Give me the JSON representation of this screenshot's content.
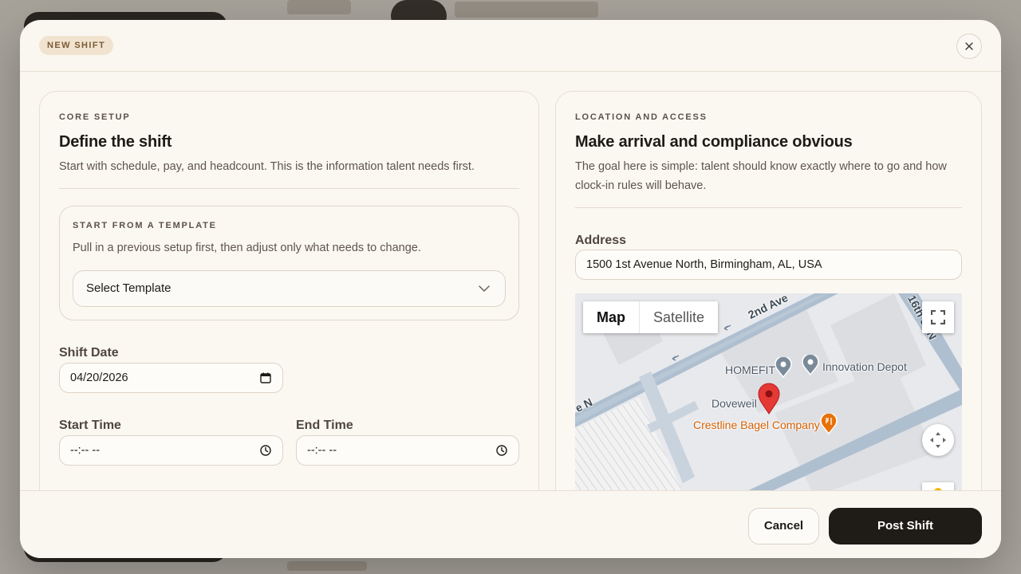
{
  "modal": {
    "badge": "NEW SHIFT",
    "close_icon": "close-icon"
  },
  "core": {
    "eyebrow": "CORE SETUP",
    "title": "Define the shift",
    "description": "Start with schedule, pay, and headcount. This is the information talent needs first.",
    "template": {
      "eyebrow": "START FROM A TEMPLATE",
      "description": "Pull in a previous setup first, then adjust only what needs to change.",
      "select_value": "Select Template"
    },
    "shift_date": {
      "label": "Shift Date",
      "value": "04/20/2026"
    },
    "start_time": {
      "label": "Start Time",
      "value": "--:-- --"
    },
    "end_time": {
      "label": "End Time",
      "value": "--:-- --"
    }
  },
  "location": {
    "eyebrow": "LOCATION AND ACCESS",
    "title": "Make arrival and compliance obvious",
    "description_line1": "The goal here is simple: talent should know exactly where to go and how",
    "description_line2": "clock-in rules will behave.",
    "address": {
      "label": "Address",
      "value": "1500 1st Avenue North, Birmingham, AL, USA"
    },
    "map": {
      "type_map": "Map",
      "type_satellite": "Satellite",
      "selected_type": "Map",
      "streets": [
        "2nd Ave",
        "16th St N",
        "e N"
      ],
      "places": {
        "homefit": "HOMEFIT",
        "innovation_depot": "Innovation Depot",
        "doveweil": "Doveweil",
        "crestline": "Crestline Bagel Company"
      },
      "colors": {
        "pin": "#e53935",
        "poi": "#7a8a99",
        "food": "#e8710a"
      }
    }
  },
  "footer": {
    "cancel_label": "Cancel",
    "post_label": "Post Shift"
  }
}
